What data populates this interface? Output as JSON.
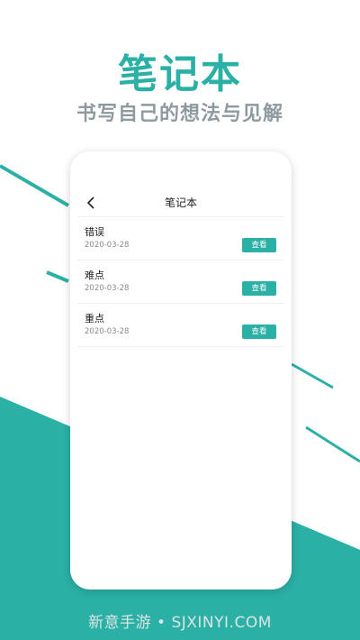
{
  "hero": {
    "title": "笔记本",
    "subtitle": "书写自己的想法与见解"
  },
  "navbar": {
    "back_icon": "chevron-left-icon",
    "title": "笔记本"
  },
  "notes": [
    {
      "title": "错误",
      "date": "2020-03-28",
      "button_label": "查看"
    },
    {
      "title": "难点",
      "date": "2020-03-28",
      "button_label": "查看"
    },
    {
      "title": "重点",
      "date": "2020-03-28",
      "button_label": "查看"
    }
  ],
  "watermark": "新意手游 • SJXINYI.COM",
  "colors": {
    "accent": "#2bb0a6",
    "subtitle": "#8e9aa0",
    "background": "#ffffff"
  }
}
